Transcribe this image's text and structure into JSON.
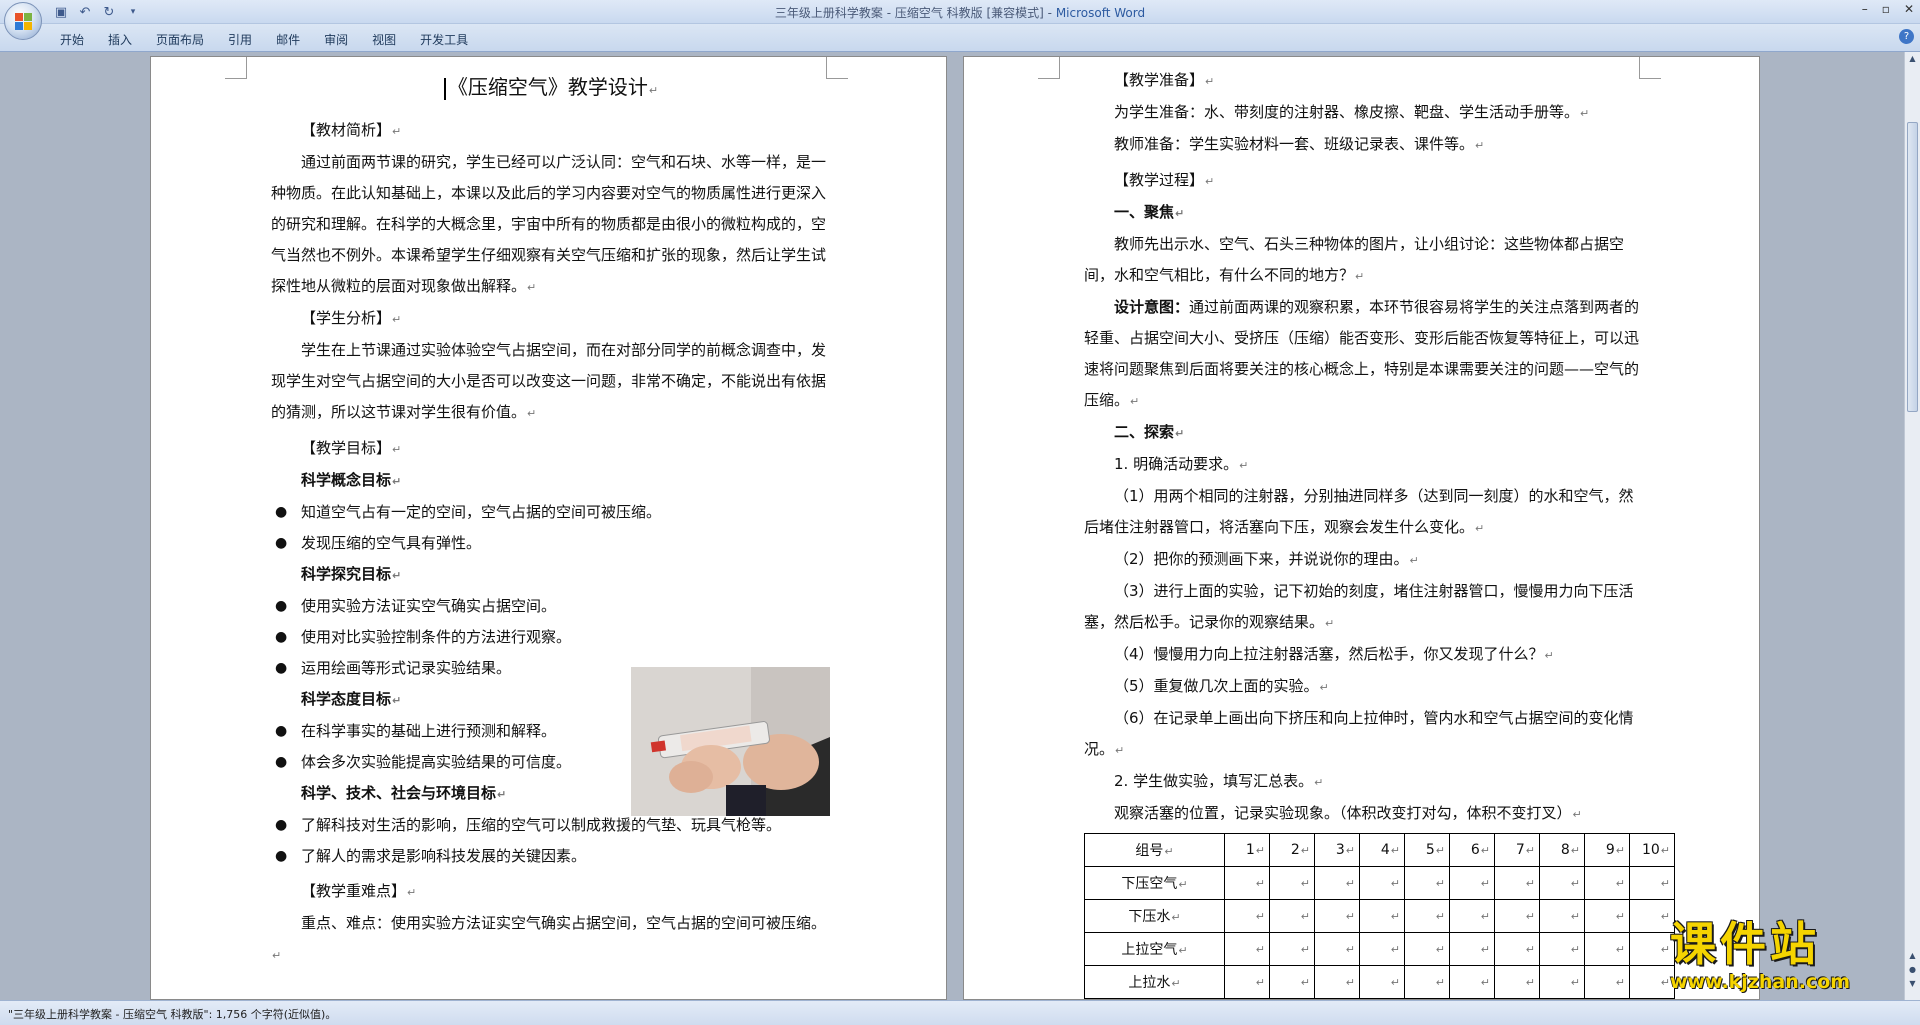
{
  "window": {
    "title": "三年级上册科学教案 - 压缩空气  科教版 [兼容模式] - ",
    "app_name": "Microsoft Word"
  },
  "ribbon": {
    "tabs": [
      "开始",
      "插入",
      "页面布局",
      "引用",
      "邮件",
      "审阅",
      "视图",
      "开发工具"
    ]
  },
  "doc_left": {
    "title": "《压缩空气》教学设计",
    "s1_heading": "【教材简析】",
    "s1_para": "通过前面两节课的研究，学生已经可以广泛认同：空气和石块、水等一样，是一种物质。在此认知基础上，本课以及此后的学习内容要对空气的物质属性进行更深入的研究和理解。在科学的大概念里，宇宙中所有的物质都是由很小的微粒构成的，空气当然也不例外。本课希望学生仔细观察有关空气压缩和扩张的现象，然后让学生试探性地从微粒的层面对现象做出解释。",
    "s2_heading": "【学生分析】",
    "s2_para": "学生在上节课通过实验体验空气占据空间，而在对部分同学的前概念调查中，发现学生对空气占据空间的大小是否可以改变这一问题，非常不确定，不能说出有依据的猜测，所以这节课对学生很有价值。",
    "s3_heading": "【教学目标】",
    "g1_heading": "科学概念目标",
    "g1_items": [
      "知道空气占有一定的空间，空气占据的空间可被压缩。",
      "发现压缩的空气具有弹性。"
    ],
    "g2_heading": "科学探究目标",
    "g2_items": [
      "使用实验方法证实空气确实占据空间。",
      "使用对比实验控制条件的方法进行观察。",
      "运用绘画等形式记录实验结果。"
    ],
    "g3_heading": "科学态度目标",
    "g3_items": [
      "在科学事实的基础上进行预测和解释。",
      "体会多次实验能提高实验结果的可信度。"
    ],
    "g4_heading": "科学、技术、社会与环境目标",
    "g4_items": [
      "了解科技对生活的影响，压缩的空气可以制成救援的气垫、玩具气枪等。",
      "了解人的需求是影响科技发展的关键因素。"
    ],
    "s4_heading": "【教学重难点】",
    "s4_para": "重点、难点：使用实验方法证实空气确实占据空间，空气占据的空间可被压缩。",
    "bullet": "●",
    "para_mark": "↵"
  },
  "doc_right": {
    "s5_heading": "【教学准备】",
    "s5_line1": "为学生准备：水、带刻度的注射器、橡皮擦、靶盘、学生活动手册等。",
    "s5_line2": "教师准备：学生实验材料一套、班级记录表、课件等。",
    "s6_heading": "【教学过程】",
    "p1_heading": "一、聚焦",
    "p1_para": "教师先出示水、空气、石头三种物体的图片，让小组讨论：这些物体都占据空间，水和空气相比，有什么不同的地方？",
    "p1_intent_label": "设计意图：",
    "p1_intent": "通过前面两课的观察积累，本环节很容易将学生的关注点落到两者的轻重、占据空间大小、受挤压（压缩）能否变形、变形后能否恢复等特征上，可以迅速将问题聚焦到后面将要关注的核心概念上，特别是本课需要关注的问题——空气的压缩。",
    "p2_heading": "二、探索",
    "step1": "1. 明确活动要求。",
    "step1_items": [
      "（1）用两个相同的注射器，分别抽进同样多（达到同一刻度）的水和空气，然后堵住注射器管口，将活塞向下压，观察会发生什么变化。",
      "（2）把你的预测画下来，并说说你的理由。",
      "（3）进行上面的实验，记下初始的刻度，堵住注射器管口，慢慢用力向下压活塞，然后松手。记录你的观察结果。",
      "（4）慢慢用力向上拉注射器活塞，然后松手，你又发现了什么？",
      "（5）重复做几次上面的实验。",
      "（6）在记录单上画出向下挤压和向上拉伸时，管内水和空气占据空间的变化情况。"
    ],
    "step2": "2. 学生做实验，填写汇总表。",
    "table_caption": "观察活塞的位置，记录实验现象。（体积改变打对勾，体积不变打叉）",
    "table_header": [
      "组号",
      "1",
      "2",
      "3",
      "4",
      "5",
      "6",
      "7",
      "8",
      "9",
      "10"
    ],
    "table_rows": [
      "下压空气",
      "下压水",
      "上拉空气",
      "上拉水"
    ]
  },
  "statusbar": {
    "text": "\"三年级上册科学教案 - 压缩空气  科教版\": 1,756 个字符(近似值)。"
  },
  "watermark": {
    "cn": "课件站",
    "url": "www.kjzhan.com"
  },
  "colors": {
    "accent": "#2c5aa0",
    "watermark": "#f5d400"
  }
}
